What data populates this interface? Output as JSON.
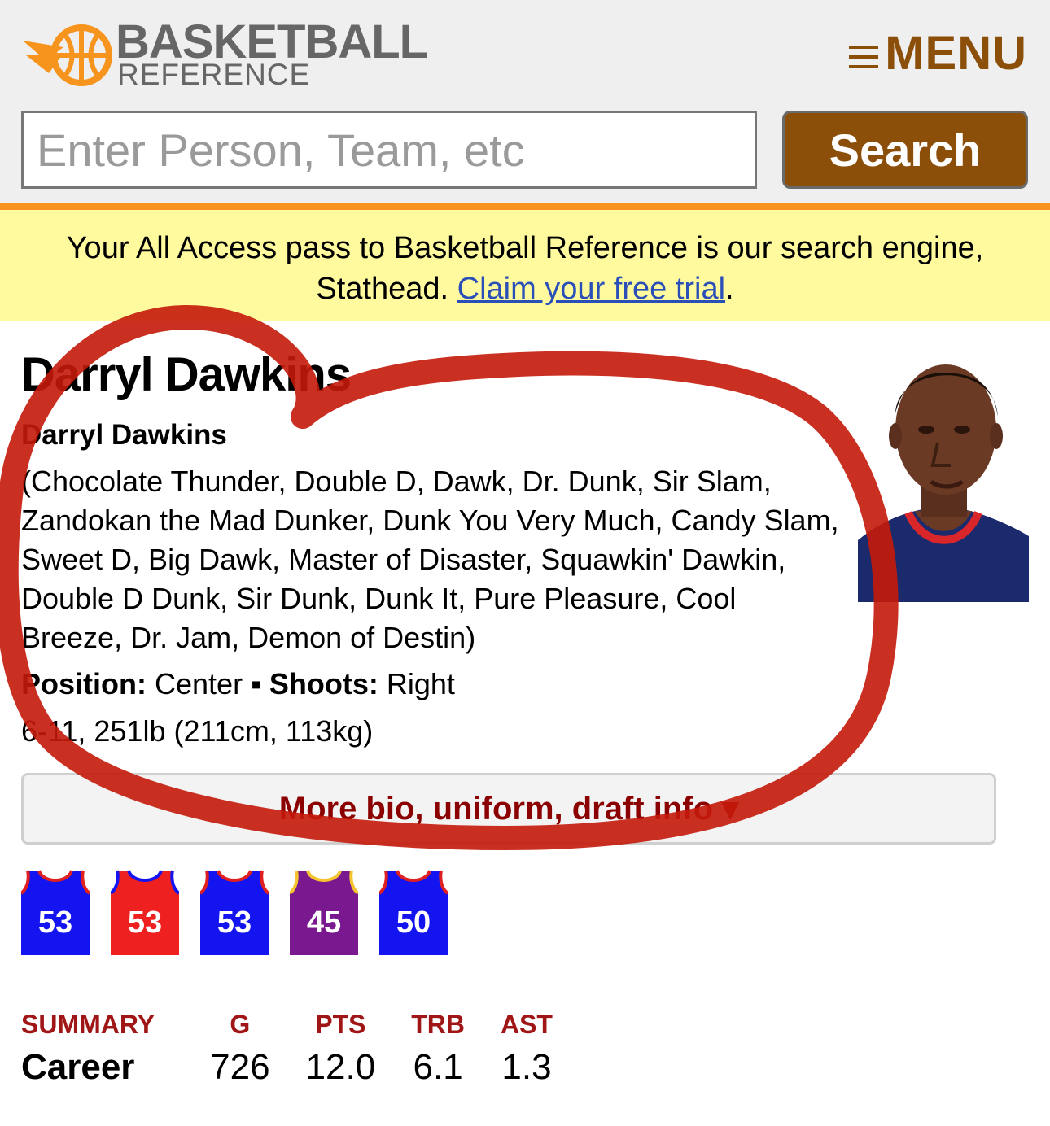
{
  "header": {
    "logo_line1": "BASKETBALL",
    "logo_line2": "REFERENCE",
    "menu_label": "MENU",
    "menu_icon": "hamburger-icon",
    "colors": {
      "header_bg": "#efefef",
      "brand_brown": "#8b4f0a",
      "brand_orange": "#f7941d"
    }
  },
  "search": {
    "placeholder": "Enter Person, Team, etc",
    "value": "",
    "button_label": "Search"
  },
  "promo": {
    "text_before": "Your All Access pass to Basketball Reference is our search engine, Stathead. ",
    "link_text": "Claim your free trial",
    "text_after": "."
  },
  "player": {
    "name": "Darryl Dawkins",
    "full_name": "Darryl Dawkins",
    "nicknames": "(Chocolate Thunder, Double D, Dawk, Dr. Dunk, Sir Slam, Zandokan the Mad Dunker, Dunk You Very Much, Candy Slam, Sweet D, Big Dawk, Master of Disaster, Squawkin' Dawkin, Double D Dunk, Sir Dunk, Dunk It, Pure Pleasure, Cool Breeze, Dr. Jam, Demon of Destin)",
    "position_label": "Position:",
    "position": "Center",
    "separator": "▪",
    "shoots_label": "Shoots:",
    "shoots": "Right",
    "height_weight": "6-11, 251lb (211cm, 113kg)"
  },
  "more_bio": {
    "label": "More bio, uniform, draft info",
    "icon": "caret-down-icon",
    "glyph": "▾"
  },
  "jerseys": [
    {
      "number": "53",
      "color": "#1414f0",
      "trim": "#e02020"
    },
    {
      "number": "53",
      "color": "#ee2020",
      "trim": "#1414f0"
    },
    {
      "number": "53",
      "color": "#1414f0",
      "trim": "#e02020"
    },
    {
      "number": "45",
      "color": "#7a1890",
      "trim": "#f4c430"
    },
    {
      "number": "50",
      "color": "#1414f0",
      "trim": "#e02020"
    }
  ],
  "summary": {
    "headers": [
      "SUMMARY",
      "G",
      "PTS",
      "TRB",
      "AST"
    ],
    "row": [
      "Career",
      "726",
      "12.0",
      "6.1",
      "1.3"
    ]
  },
  "annotation": {
    "color": "#c41a0a",
    "description_icon": "hand-drawn-circle"
  }
}
